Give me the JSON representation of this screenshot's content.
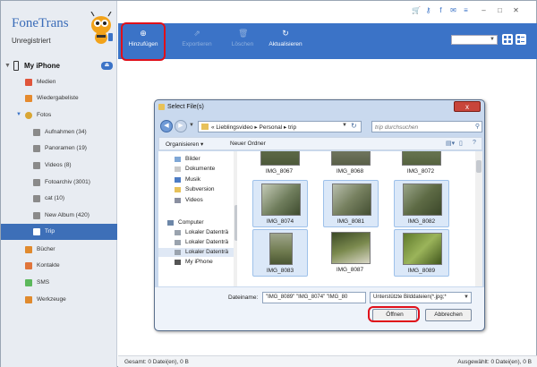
{
  "app": {
    "name": "FoneTrans",
    "registration": "Unregistriert"
  },
  "device": {
    "name": "My iPhone"
  },
  "sidebar": {
    "items": [
      {
        "label": "Medien",
        "color": "#e0553b"
      },
      {
        "label": "Wiedergabeliste",
        "color": "#e58a2e"
      },
      {
        "label": "Fotos",
        "color": "#d9a634"
      },
      {
        "label": "Aufnahmen (34)",
        "color": "#8a8a8a"
      },
      {
        "label": "Panoramen (19)",
        "color": "#8a8a8a"
      },
      {
        "label": "Videos (8)",
        "color": "#8a8a8a"
      },
      {
        "label": "Fotoarchiv (3001)",
        "color": "#8a8a8a"
      },
      {
        "label": "cat (10)",
        "color": "#8a8a8a"
      },
      {
        "label": "New Album (420)",
        "color": "#8a8a8a"
      },
      {
        "label": "Trip",
        "color": "#ffffff"
      },
      {
        "label": "Bücher",
        "color": "#e08a2e"
      },
      {
        "label": "Kontakte",
        "color": "#e0753b"
      },
      {
        "label": "SMS",
        "color": "#5cb85c"
      },
      {
        "label": "Werkzeuge",
        "color": "#e08a2e"
      }
    ]
  },
  "toolbar": {
    "add": "Hinzufügen",
    "export": "Exportieren",
    "delete": "Löschen",
    "refresh": "Aktualisieren"
  },
  "status": {
    "total": "Gesamt: 0 Datei(en), 0 B",
    "selected": "Ausgewählt: 0 Datei(en), 0 B"
  },
  "dialog": {
    "title": "Select File(s)",
    "close": "x",
    "path": [
      "Lieblingsvideo",
      "Personal",
      "trip"
    ],
    "search_placeholder": "trip durchsuchen",
    "organize": "Organisieren",
    "new_folder": "Neuer Ordner",
    "nav_items": [
      "Bilder",
      "Dokumente",
      "Musik",
      "Subversion",
      "Videos",
      "Computer",
      "Lokaler Datenträ",
      "Lokaler Datenträ",
      "Lokaler Datenträ",
      "My iPhone"
    ],
    "files": [
      "IMG_8067",
      "IMG_8068",
      "IMG_8072",
      "IMG_8074",
      "IMG_8081",
      "IMG_8082",
      "IMG_8083",
      "IMG_8087",
      "IMG_8089"
    ],
    "filename_label": "Dateiname:",
    "filename_value": "\"IMG_8089\" \"IMG_8074\" \"IMG_80",
    "filetype_value": "Unterstützte Bilddateien(*.jpg;*",
    "open": "Öffnen",
    "cancel": "Abbrechen"
  },
  "colors": {
    "accent": "#3b73c7",
    "highlight": "#e0101a"
  }
}
